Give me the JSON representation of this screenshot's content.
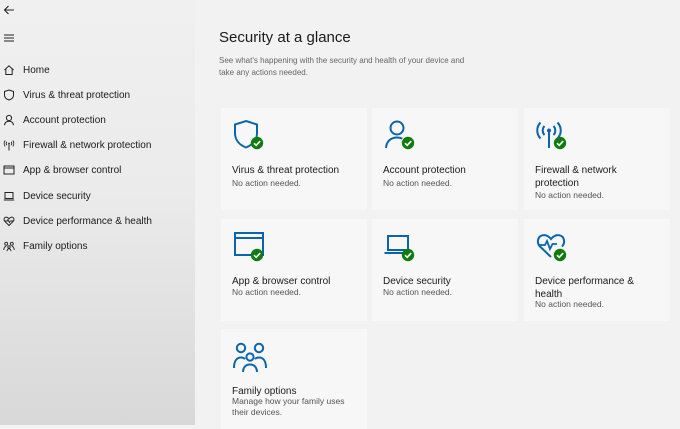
{
  "sidebar": {
    "items": [
      {
        "label": "Home",
        "icon": "home-icon"
      },
      {
        "label": "Virus & threat protection",
        "icon": "shield-icon"
      },
      {
        "label": "Account protection",
        "icon": "person-icon"
      },
      {
        "label": "Firewall & network protection",
        "icon": "antenna-icon"
      },
      {
        "label": "App & browser control",
        "icon": "app-window-icon"
      },
      {
        "label": "Device security",
        "icon": "laptop-icon"
      },
      {
        "label": "Device performance & health",
        "icon": "heart-pulse-icon"
      },
      {
        "label": "Family options",
        "icon": "family-icon"
      }
    ]
  },
  "main": {
    "title": "Security at a glance",
    "subtitle": "See what's happening with the security and health of your device and take any actions needed.",
    "cards": [
      {
        "title": "Virus & threat protection",
        "status": "No action needed."
      },
      {
        "title": "Account protection",
        "status": "No action needed."
      },
      {
        "title": "Firewall & network protection",
        "status": "No action needed."
      },
      {
        "title": "App & browser control",
        "status": "No action needed."
      },
      {
        "title": "Device security",
        "status": "No action needed."
      },
      {
        "title": "Device performance & health",
        "status": "No action needed."
      },
      {
        "title": "Family options",
        "status": "Manage how your family uses their devices."
      }
    ]
  },
  "colors": {
    "accent": "#0a64ad",
    "ok_badge": "#107c10"
  }
}
